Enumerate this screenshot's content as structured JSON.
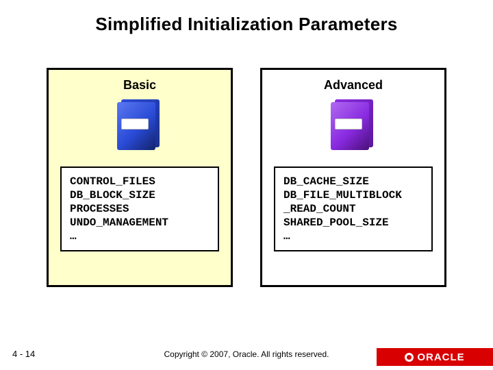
{
  "title": "Simplified Initialization Parameters",
  "panels": {
    "basic": {
      "heading": "Basic",
      "params": [
        "CONTROL_FILES",
        "DB_BLOCK_SIZE",
        "PROCESSES",
        "UNDO_MANAGEMENT",
        "…"
      ]
    },
    "advanced": {
      "heading": "Advanced",
      "params": [
        "DB_CACHE_SIZE",
        "DB_FILE_MULTIBLOCK",
        "_READ_COUNT",
        "SHARED_POOL_SIZE",
        "…"
      ]
    }
  },
  "footer": {
    "page": "4 - 14",
    "copyright": "Copyright © 2007, Oracle. All rights reserved.",
    "logo_text": "ORACLE"
  }
}
